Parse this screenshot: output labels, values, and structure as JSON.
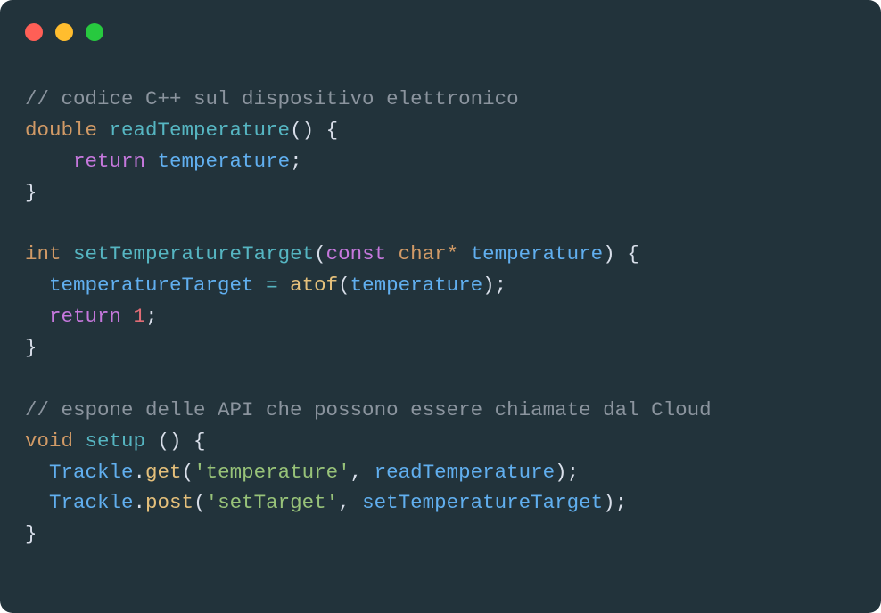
{
  "window": {
    "traffic_lights": [
      "close",
      "minimize",
      "zoom"
    ]
  },
  "code": {
    "language": "cpp",
    "lines": [
      [
        {
          "cls": "c-comment",
          "t": "// codice C++ sul dispositivo elettronico"
        }
      ],
      [
        {
          "cls": "c-type",
          "t": "double"
        },
        {
          "cls": "c-punct",
          "t": " "
        },
        {
          "cls": "c-func",
          "t": "readTemperature"
        },
        {
          "cls": "c-punct",
          "t": "() {"
        }
      ],
      [
        {
          "cls": "c-punct",
          "t": "    "
        },
        {
          "cls": "c-keyword",
          "t": "return"
        },
        {
          "cls": "c-punct",
          "t": " "
        },
        {
          "cls": "c-ident",
          "t": "temperature"
        },
        {
          "cls": "c-punct",
          "t": ";"
        }
      ],
      [
        {
          "cls": "c-punct",
          "t": "}"
        }
      ],
      [
        {
          "cls": "c-punct",
          "t": ""
        }
      ],
      [
        {
          "cls": "c-type",
          "t": "int"
        },
        {
          "cls": "c-punct",
          "t": " "
        },
        {
          "cls": "c-func",
          "t": "setTemperatureTarget"
        },
        {
          "cls": "c-punct",
          "t": "("
        },
        {
          "cls": "c-keyword",
          "t": "const"
        },
        {
          "cls": "c-punct",
          "t": " "
        },
        {
          "cls": "c-type",
          "t": "char*"
        },
        {
          "cls": "c-punct",
          "t": " "
        },
        {
          "cls": "c-ident",
          "t": "temperature"
        },
        {
          "cls": "c-punct",
          "t": ") {"
        }
      ],
      [
        {
          "cls": "c-punct",
          "t": "  "
        },
        {
          "cls": "c-ident",
          "t": "temperatureTarget"
        },
        {
          "cls": "c-punct",
          "t": " "
        },
        {
          "cls": "c-op",
          "t": "="
        },
        {
          "cls": "c-punct",
          "t": " "
        },
        {
          "cls": "c-call",
          "t": "atof"
        },
        {
          "cls": "c-punct",
          "t": "("
        },
        {
          "cls": "c-ident",
          "t": "temperature"
        },
        {
          "cls": "c-punct",
          "t": ");"
        }
      ],
      [
        {
          "cls": "c-punct",
          "t": "  "
        },
        {
          "cls": "c-keyword",
          "t": "return"
        },
        {
          "cls": "c-punct",
          "t": " "
        },
        {
          "cls": "c-num",
          "t": "1"
        },
        {
          "cls": "c-punct",
          "t": ";"
        }
      ],
      [
        {
          "cls": "c-punct",
          "t": "}"
        }
      ],
      [
        {
          "cls": "c-punct",
          "t": ""
        }
      ],
      [
        {
          "cls": "c-comment",
          "t": "// espone delle API che possono essere chiamate dal Cloud"
        }
      ],
      [
        {
          "cls": "c-type",
          "t": "void"
        },
        {
          "cls": "c-punct",
          "t": " "
        },
        {
          "cls": "c-func",
          "t": "setup"
        },
        {
          "cls": "c-punct",
          "t": " () {"
        }
      ],
      [
        {
          "cls": "c-punct",
          "t": "  "
        },
        {
          "cls": "c-ident",
          "t": "Trackle"
        },
        {
          "cls": "c-punct",
          "t": "."
        },
        {
          "cls": "c-call",
          "t": "get"
        },
        {
          "cls": "c-punct",
          "t": "("
        },
        {
          "cls": "c-str",
          "t": "'temperature'"
        },
        {
          "cls": "c-punct",
          "t": ", "
        },
        {
          "cls": "c-ident",
          "t": "readTemperature"
        },
        {
          "cls": "c-punct",
          "t": ");"
        }
      ],
      [
        {
          "cls": "c-punct",
          "t": "  "
        },
        {
          "cls": "c-ident",
          "t": "Trackle"
        },
        {
          "cls": "c-punct",
          "t": "."
        },
        {
          "cls": "c-call",
          "t": "post"
        },
        {
          "cls": "c-punct",
          "t": "("
        },
        {
          "cls": "c-str",
          "t": "'setTarget'"
        },
        {
          "cls": "c-punct",
          "t": ", "
        },
        {
          "cls": "c-ident",
          "t": "setTemperatureTarget"
        },
        {
          "cls": "c-punct",
          "t": ");"
        }
      ],
      [
        {
          "cls": "c-punct",
          "t": "}"
        }
      ]
    ]
  }
}
